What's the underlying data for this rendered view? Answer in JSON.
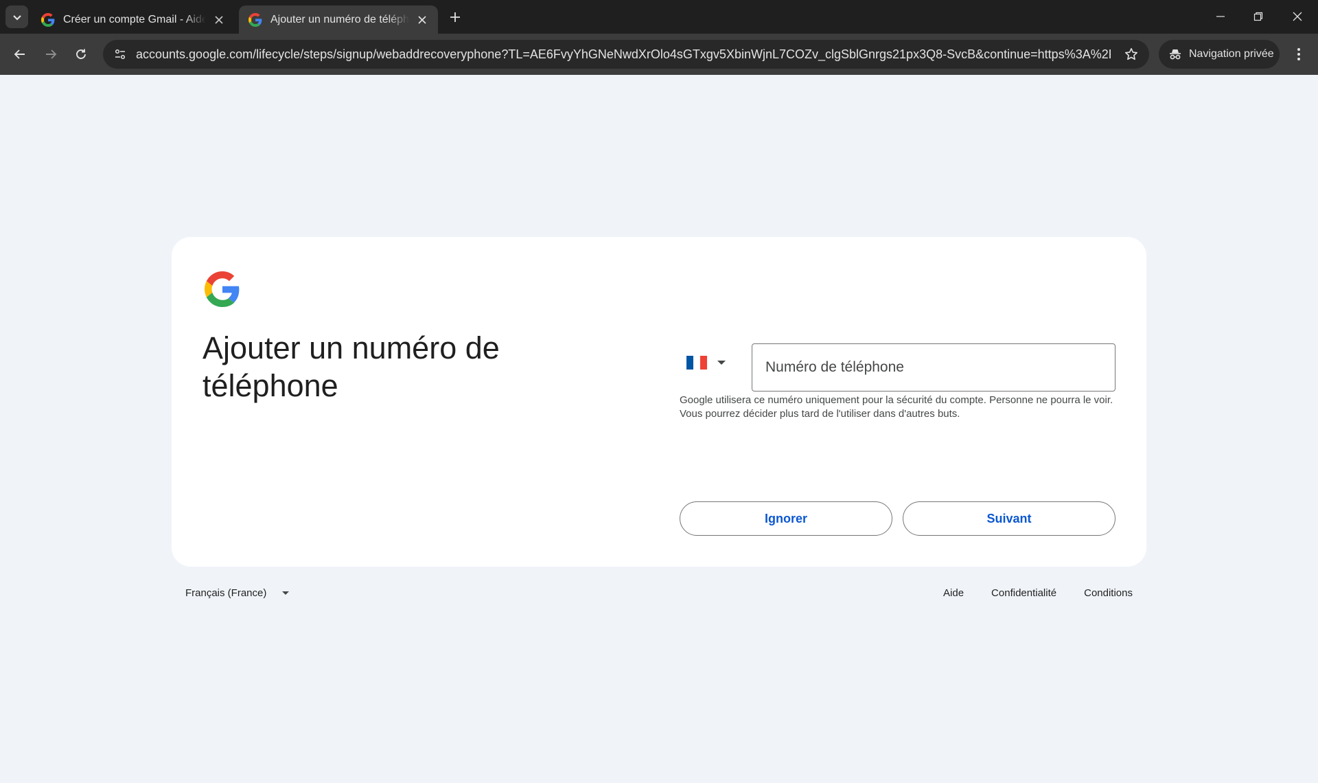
{
  "browser": {
    "tabs": [
      {
        "title": "Créer un compte Gmail - Aide Gmail",
        "active": false
      },
      {
        "title": "Ajouter un numéro de téléphone",
        "active": true
      }
    ],
    "url": "accounts.google.com/lifecycle/steps/signup/webaddrecoveryphone?TL=AE6FvyYhGNeNwdXrOlo4sGTxgv5XbinWjnL7COZv_clgSblGnrgs21px3Q8-SvcB&continue=https%3A%2F%2Fm...",
    "incognito_label": "Navigation privée"
  },
  "page": {
    "heading": "Ajouter un numéro de téléphone",
    "country_flag": {
      "colors": [
        "#0055a4",
        "#ffffff",
        "#ef4135"
      ]
    },
    "phone_placeholder": "Numéro de téléphone",
    "phone_value": "",
    "hint": "Google utilisera ce numéro uniquement pour la sécurité du compte. Personne ne pourra le voir. Vous pourrez décider plus tard de l'utiliser dans d'autres buts.",
    "skip_label": "Ignorer",
    "next_label": "Suivant"
  },
  "footer": {
    "language": "Français (France)",
    "links": [
      "Aide",
      "Confidentialité",
      "Conditions"
    ]
  },
  "colors": {
    "page_bg": "#f0f4f9",
    "card_bg": "#ffffff",
    "accent": "#0b57d0"
  }
}
